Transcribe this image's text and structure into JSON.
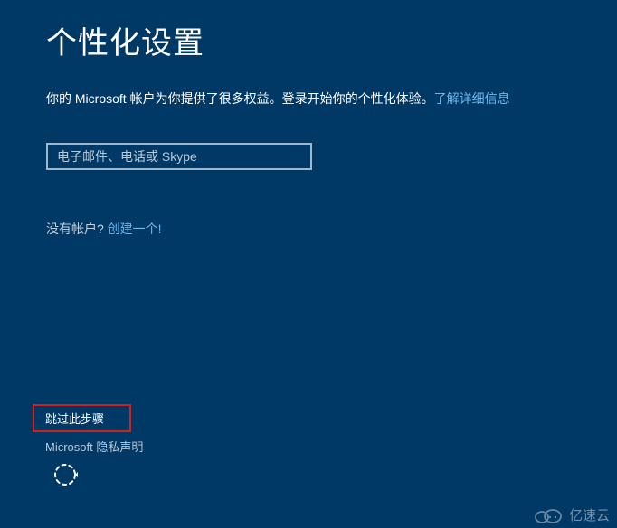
{
  "header": {
    "title": "个性化设置"
  },
  "body": {
    "description": "你的 Microsoft 帐户为你提供了很多权益。登录开始你的个性化体验。",
    "learn_more": "了解详细信息",
    "input_placeholder": "电子邮件、电话或 Skype",
    "no_account_text": "没有帐户? ",
    "create_account": "创建一个!"
  },
  "footer": {
    "skip_step": "跳过此步骤",
    "privacy": "Microsoft 隐私声明"
  },
  "watermark": {
    "text": "亿速云"
  },
  "colors": {
    "background": "#003866",
    "link": "#6cb8f0",
    "highlight_border": "#d02020"
  }
}
